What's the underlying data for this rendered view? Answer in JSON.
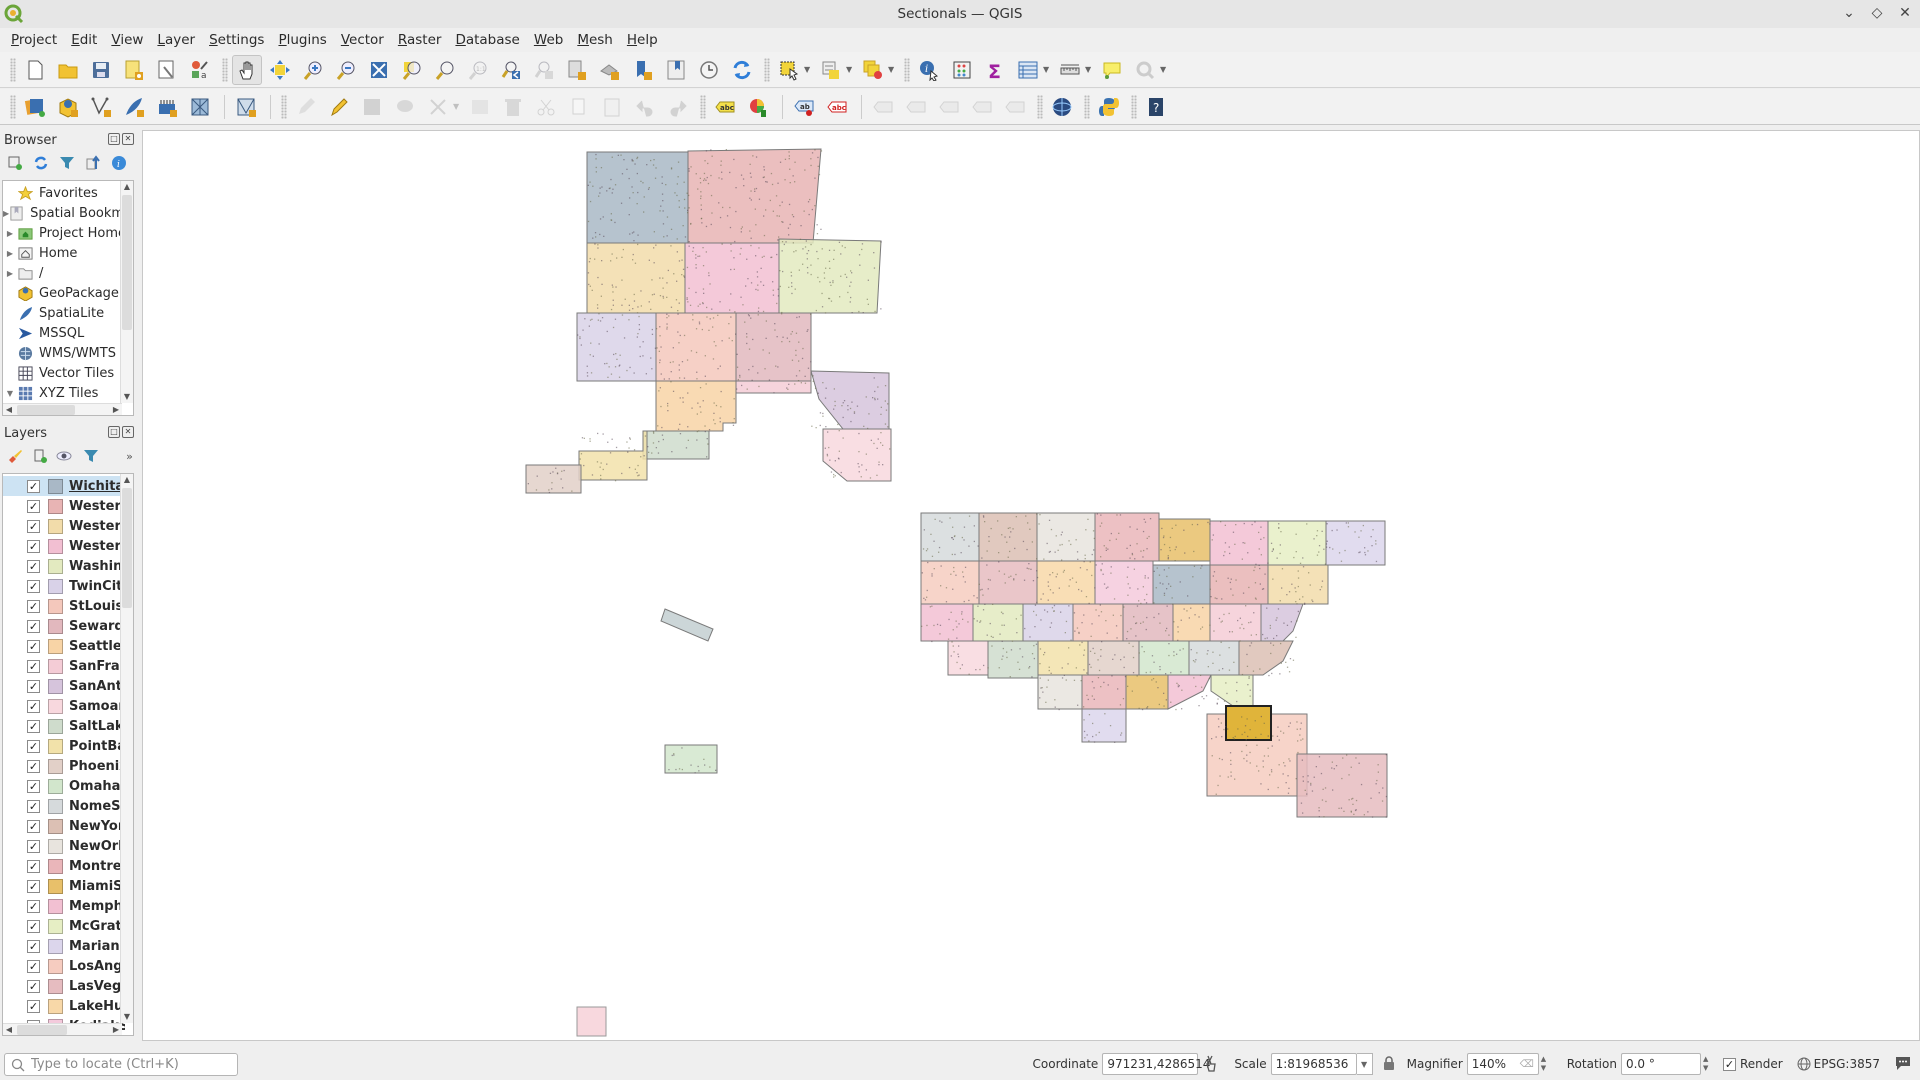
{
  "window": {
    "title": "Sectionals — QGIS",
    "controls": [
      "minimize",
      "maximize",
      "close"
    ]
  },
  "menu": [
    "Project",
    "Edit",
    "View",
    "Layer",
    "Settings",
    "Plugins",
    "Vector",
    "Raster",
    "Database",
    "Web",
    "Mesh",
    "Help"
  ],
  "toolbar1": [
    {
      "name": "new-project-icon"
    },
    {
      "name": "open-project-icon"
    },
    {
      "name": "save-project-icon"
    },
    {
      "name": "new-print-layout-icon"
    },
    {
      "name": "layout-manager-icon"
    },
    {
      "name": "style-manager-icon"
    },
    {
      "name": "pan-map-icon",
      "active": true
    },
    {
      "name": "pan-to-selection-icon"
    },
    {
      "name": "zoom-in-icon"
    },
    {
      "name": "zoom-out-icon"
    },
    {
      "name": "zoom-full-icon"
    },
    {
      "name": "zoom-to-selection-icon"
    },
    {
      "name": "zoom-to-layer-icon"
    },
    {
      "name": "zoom-native-icon",
      "disabled": true
    },
    {
      "name": "zoom-last-icon"
    },
    {
      "name": "zoom-next-icon",
      "disabled": true
    },
    {
      "name": "new-map-view-icon"
    },
    {
      "name": "new-3d-map-view-icon"
    },
    {
      "name": "new-bookmark-icon"
    },
    {
      "name": "show-bookmarks-icon"
    },
    {
      "name": "temporal-controller-icon"
    },
    {
      "name": "refresh-icon"
    },
    {
      "name": "select-features-icon"
    },
    {
      "name": "select-by-attribute-icon"
    },
    {
      "name": "deselect-features-icon"
    },
    {
      "name": "identify-features-icon"
    },
    {
      "name": "statistics-icon"
    },
    {
      "name": "sum-icon"
    },
    {
      "name": "attribute-table-icon"
    },
    {
      "name": "measure-icon"
    },
    {
      "name": "map-tips-icon"
    },
    {
      "name": "locator-settings-icon",
      "disabled": true
    }
  ],
  "toolbar2": [
    {
      "name": "data-source-manager-icon"
    },
    {
      "name": "new-geopackage-layer-icon"
    },
    {
      "name": "new-shapefile-layer-icon"
    },
    {
      "name": "new-spatialite-layer-icon"
    },
    {
      "name": "new-temporary-layer-icon"
    },
    {
      "name": "new-virtual-layer-icon"
    },
    {
      "name": "digitize-icon"
    },
    {
      "name": "current-edits-icon",
      "disabled": true
    },
    {
      "name": "toggle-editing-icon"
    },
    {
      "name": "save-edits-icon",
      "disabled": true
    },
    {
      "name": "add-polygon-icon",
      "disabled": true
    },
    {
      "name": "vertex-tool-icon",
      "disabled": true
    },
    {
      "name": "modify-attributes-icon",
      "disabled": true
    },
    {
      "name": "delete-selected-icon",
      "disabled": true
    },
    {
      "name": "cut-features-icon",
      "disabled": true
    },
    {
      "name": "copy-features-icon",
      "disabled": true
    },
    {
      "name": "paste-features-icon",
      "disabled": true
    },
    {
      "name": "undo-icon",
      "disabled": true
    },
    {
      "name": "redo-icon",
      "disabled": true
    },
    {
      "name": "label-tool-icon"
    },
    {
      "name": "diagram-tool-icon"
    },
    {
      "name": "pin-labels-icon"
    },
    {
      "name": "show-hide-labels-icon"
    },
    {
      "name": "move-label-icon",
      "disabled": true
    },
    {
      "name": "rotate-label-icon",
      "disabled": true
    },
    {
      "name": "change-label-icon",
      "disabled": true
    },
    {
      "name": "move-diagram-icon",
      "disabled": true
    },
    {
      "name": "label-properties-icon",
      "disabled": true
    },
    {
      "name": "globe-plugin-icon"
    },
    {
      "name": "python-console-icon"
    },
    {
      "name": "help-icon"
    }
  ],
  "browser": {
    "title": "Browser",
    "tools": [
      "add-selected-layers-icon",
      "refresh-icon",
      "filter-icon",
      "collapse-all-icon",
      "properties-icon"
    ],
    "items": [
      {
        "label": "Favorites",
        "icon": "star-icon",
        "expandable": false
      },
      {
        "label": "Spatial Bookmarks",
        "icon": "bookmark-icon",
        "expandable": true
      },
      {
        "label": "Project Home",
        "icon": "project-home-icon",
        "expandable": true
      },
      {
        "label": "Home",
        "icon": "home-folder-icon",
        "expandable": true
      },
      {
        "label": "/",
        "icon": "folder-icon",
        "expandable": true
      },
      {
        "label": "GeoPackage",
        "icon": "geopackage-icon",
        "expandable": false
      },
      {
        "label": "SpatiaLite",
        "icon": "spatialite-icon",
        "expandable": false
      },
      {
        "label": "MSSQL",
        "icon": "mssql-icon",
        "expandable": false
      },
      {
        "label": "WMS/WMTS",
        "icon": "wms-icon",
        "expandable": false
      },
      {
        "label": "Vector Tiles",
        "icon": "vector-tiles-icon",
        "expandable": false
      },
      {
        "label": "XYZ Tiles",
        "icon": "xyz-tiles-icon",
        "expanded": true
      }
    ]
  },
  "layers": {
    "title": "Layers",
    "tools": [
      "open-styling-icon",
      "add-group-icon",
      "manage-visibility-icon",
      "filter-legend-icon",
      "more-icon"
    ],
    "items": [
      {
        "label": "WichitaSEC",
        "color": "#a9b8c6",
        "checked": true,
        "selected": true
      },
      {
        "label": "WesternAleutian",
        "color": "#e8b4b4",
        "checked": true
      },
      {
        "label": "WesternAleutianIslands",
        "color": "#f2dcaa",
        "checked": true
      },
      {
        "label": "WesternAleutianIslandsEast",
        "color": "#f2bfd2",
        "checked": true
      },
      {
        "label": "WashingtonSEC",
        "color": "#e3eac0",
        "checked": true
      },
      {
        "label": "TwinCitiesSEC",
        "color": "#d9d2e8",
        "checked": true
      },
      {
        "label": "StLouisSEC",
        "color": "#f4c8bc",
        "checked": true
      },
      {
        "label": "SewardSEC",
        "color": "#e2b8be",
        "checked": true
      },
      {
        "label": "SeattleSEC",
        "color": "#f8d4a6",
        "checked": true
      },
      {
        "label": "SanFranciscoSEC",
        "color": "#f4ccd6",
        "checked": true
      },
      {
        "label": "SanAntonioSEC",
        "color": "#d6c4dc",
        "checked": true
      },
      {
        "label": "SamoanIslandsSEC",
        "color": "#f8d8de",
        "checked": true
      },
      {
        "label": "SaltLakeCitySEC",
        "color": "#cfdccc",
        "checked": true
      },
      {
        "label": "PointBarrowSEC",
        "color": "#f2e2aa",
        "checked": true
      },
      {
        "label": "PhoenixSEC",
        "color": "#e2d0c8",
        "checked": true
      },
      {
        "label": "OmahaSEC",
        "color": "#d2e6cc",
        "checked": true
      },
      {
        "label": "NomeSEC",
        "color": "#d6dadc",
        "checked": true
      },
      {
        "label": "NewYorkSEC",
        "color": "#dcc0b4",
        "checked": true
      },
      {
        "label": "NewOrleansSEC",
        "color": "#e8e4de",
        "checked": true
      },
      {
        "label": "MontrealSEC",
        "color": "#eab6ba",
        "checked": true
      },
      {
        "label": "MiamiSEC",
        "color": "#e8c06a",
        "checked": true
      },
      {
        "label": "MemphisSEC",
        "color": "#f2c0d2",
        "checked": true
      },
      {
        "label": "McGrathSEC",
        "color": "#e6eec4",
        "checked": true
      },
      {
        "label": "MarianaIslandsSEC",
        "color": "#dcd6ec",
        "checked": true
      },
      {
        "label": "LosAngelesSEC",
        "color": "#f6ccc0",
        "checked": true
      },
      {
        "label": "LasVegasSEC",
        "color": "#e6bcc0",
        "checked": true
      },
      {
        "label": "LakeHuronSEC",
        "color": "#f8d8a8",
        "checked": true
      },
      {
        "label": "KodiakSEC",
        "color": "#f4cadc",
        "checked": true
      }
    ]
  },
  "statusbar": {
    "locator_placeholder": "Type to locate (Ctrl+K)",
    "coordinate_label": "Coordinate",
    "coordinate_value": "971231,4286514",
    "scale_label": "Scale",
    "scale_value": "1:81968536",
    "magnifier_label": "Magnifier",
    "magnifier_value": "140%",
    "rotation_label": "Rotation",
    "rotation_value": "0.0 °",
    "render_label": "Render",
    "render_checked": true,
    "crs_label": "EPSG:3857"
  },
  "map": {
    "selected_layer_highlight": "#e0b43a"
  }
}
